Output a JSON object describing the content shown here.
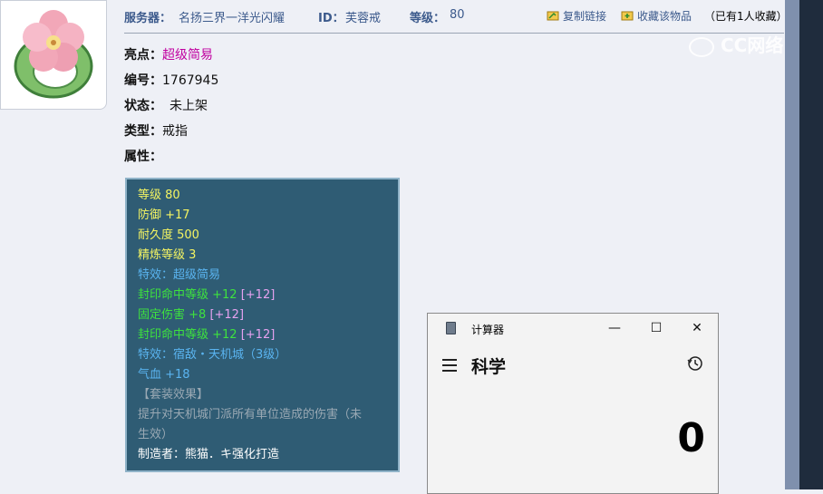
{
  "header": {
    "server_label": "服务器：",
    "server_value": "名扬三界一洋光闪耀",
    "id_label": "ID：",
    "id_value": "芙蓉戒",
    "level_label": "等级：",
    "level_value": "80",
    "copy_link": "复制链接",
    "collect_item": "收藏该物品",
    "collect_count": "（已有1人收藏）"
  },
  "watermark": {
    "text": "CC网络"
  },
  "item_info": {
    "highlight_label": "亮点：",
    "highlight_value": "超级简易",
    "number_label": "编号：",
    "number_value": "1767945",
    "status_label": "状态：",
    "status_value": "未上架",
    "type_label": "类型：",
    "type_value": "戒指",
    "attr_label": "属性："
  },
  "stats": [
    "等级 80",
    "防御 +17",
    "耐久度 500",
    "精炼等级 3",
    "特效：超级简易",
    "封印命中等级 +12",
    "[+12]",
    "固定伤害 +8",
    "[+12]",
    "封印命中等级 +12",
    "[+12]",
    "特效：宿敌・天机城（3级）",
    "气血 +18",
    "【套装效果】",
    "提升对天机城门派所有单位造成的伤害（未",
    "生效）",
    "制造者：熊猫．キ强化打造"
  ],
  "calculator": {
    "title": "计算器",
    "mode": "科学",
    "display": "0",
    "minimize": "—",
    "maximize": "☐",
    "close": "✕"
  },
  "icons": {
    "item": "jade-ring-with-pink-flower-icon",
    "copy": "copy-link-icon",
    "collect": "collect-icon",
    "menu": "hamburger-menu-icon",
    "history": "history-icon"
  }
}
